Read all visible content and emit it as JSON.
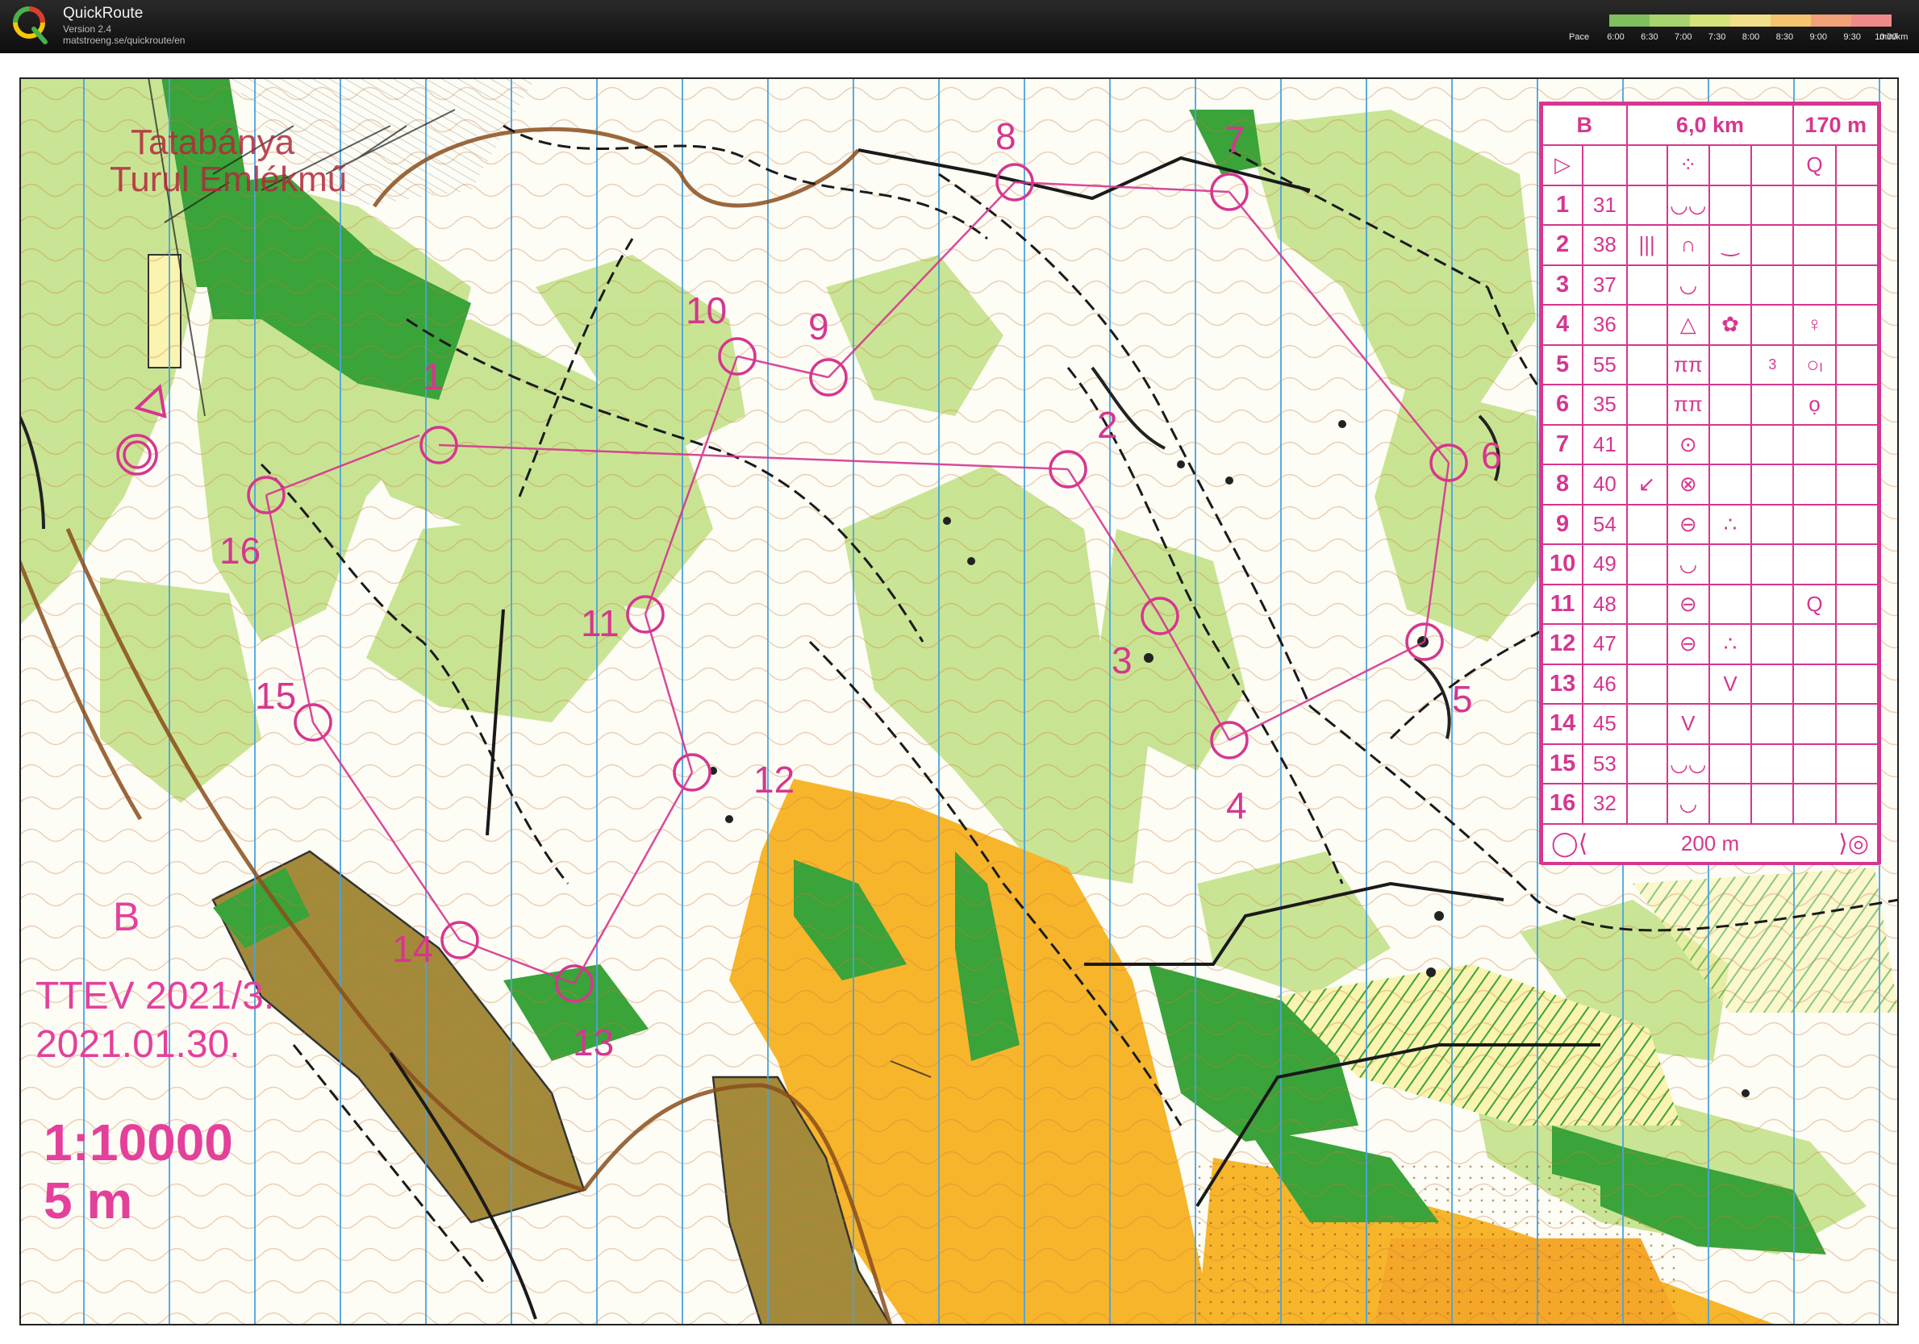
{
  "app": {
    "title": "QuickRoute",
    "version": "Version 2.4",
    "url": "matstroeng.se/quickroute/en"
  },
  "pace_legend": {
    "label": "Pace",
    "ticks": [
      "6:00",
      "6:30",
      "7:00",
      "7:30",
      "8:00",
      "8:30",
      "9:00",
      "9:30",
      "10:00"
    ],
    "units": "min/km",
    "colors": [
      "#7fbf5f",
      "#a8d470",
      "#d6e27a",
      "#f0e08a",
      "#f5c46f",
      "#f2a07a",
      "#ee8a8a"
    ]
  },
  "map": {
    "title_line1": "Tatabánya",
    "title_line2": "Turul Emlékmű",
    "class_label": "B",
    "event_line1": "TTEV 2021/3.",
    "event_line2": "2021.01.30.",
    "scale": "1:10000",
    "contour": "5 m",
    "controls": [
      "1",
      "2",
      "3",
      "4",
      "5",
      "6",
      "7",
      "8",
      "9",
      "10",
      "11",
      "12",
      "13",
      "14",
      "15",
      "16"
    ],
    "colors": {
      "open": "#f7b52c",
      "forest": "#ffffff",
      "green_light": "#c6e38e",
      "green_dark": "#3aa33a",
      "contour": "#c8651e",
      "course": "#d6368f",
      "magnetic": "#4aa3df"
    }
  },
  "descriptions": {
    "header": {
      "class": "B",
      "length": "6,0 km",
      "climb": "170 m"
    },
    "rows": [
      {
        "num": "1",
        "code": "31",
        "c": "",
        "d": "◡◡",
        "e": "",
        "f": ""
      },
      {
        "num": "2",
        "code": "38",
        "c": "|||",
        "d": "∩",
        "e": "‿",
        "f": ""
      },
      {
        "num": "3",
        "code": "37",
        "c": "",
        "d": "◡",
        "e": "",
        "f": ""
      },
      {
        "num": "4",
        "code": "36",
        "c": "",
        "d": "△",
        "e": "✿",
        "f": "♀"
      },
      {
        "num": "5",
        "code": "55",
        "c": "",
        "d": "ππ",
        "e": "3",
        "f": "○ₗ"
      },
      {
        "num": "6",
        "code": "35",
        "c": "",
        "d": "ππ",
        "e": "",
        "f": "ọ"
      },
      {
        "num": "7",
        "code": "41",
        "c": "",
        "d": "⊙",
        "e": "",
        "f": ""
      },
      {
        "num": "8",
        "code": "40",
        "c": "↙",
        "d": "⊗",
        "e": "",
        "f": ""
      },
      {
        "num": "9",
        "code": "54",
        "c": "",
        "d": "⊖",
        "e": "∴",
        "f": ""
      },
      {
        "num": "10",
        "code": "49",
        "c": "",
        "d": "◡",
        "e": "",
        "f": ""
      },
      {
        "num": "11",
        "code": "48",
        "c": "",
        "d": "⊖",
        "e": "",
        "f": "Q"
      },
      {
        "num": "12",
        "code": "47",
        "c": "",
        "d": "⊖",
        "e": "∴",
        "f": ""
      },
      {
        "num": "13",
        "code": "46",
        "c": "",
        "d": "",
        "e": "V",
        "f": ""
      },
      {
        "num": "14",
        "code": "45",
        "c": "",
        "d": "V",
        "e": "",
        "f": ""
      },
      {
        "num": "15",
        "code": "53",
        "c": "",
        "d": "◡◡",
        "e": "",
        "f": ""
      },
      {
        "num": "16",
        "code": "32",
        "c": "",
        "d": "◡",
        "e": "",
        "f": ""
      }
    ],
    "footer": "200 m"
  }
}
